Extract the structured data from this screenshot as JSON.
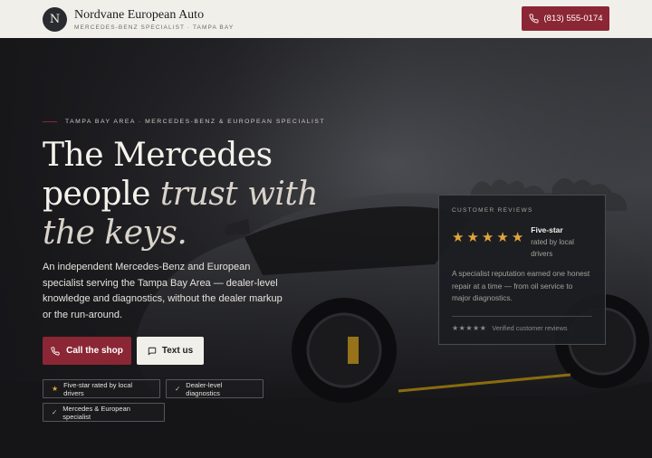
{
  "header": {
    "logo_letter": "N",
    "brand_name": "Nordvane European Auto",
    "brand_sub": "MERCEDES-BENZ SPECIALIST · TAMPA BAY",
    "phone_label": "(813) 555-0174",
    "phone_icon": "phone-icon"
  },
  "hero": {
    "eyebrow": "TAMPA BAY AREA · MERCEDES-BENZ & EUROPEAN SPECIALIST",
    "headline_line1": "The Mercedes",
    "headline_line2_plain": "people ",
    "headline_line2_italic": "trust with",
    "headline_line3_italic": "the keys.",
    "lead": "An independent Mercedes-Benz and European specialist serving the Tampa Bay Area — dealer-level knowledge and diagnostics, without the dealer markup or the run-around.",
    "call_label": "Call the shop",
    "text_label": "Text us",
    "chips": [
      {
        "label": "Five-star rated by local drivers",
        "icon": "star-icon"
      },
      {
        "label": "Dealer-level diagnostics",
        "icon": "check-icon"
      },
      {
        "label": "Mercedes & European specialist",
        "icon": "check-icon"
      }
    ]
  },
  "reviews": {
    "label": "CUSTOMER REVIEWS",
    "rating_stars": 5,
    "title": "Five-star",
    "note": "rated by local drivers",
    "body": "A specialist reputation earned one honest repair at a time — from oil service to major diagnostics.",
    "footer_stars": "★★★★★",
    "footer_text": "Verified customer reviews"
  },
  "colors": {
    "accent": "#8b2635",
    "star": "#e0a53a",
    "header_bg": "#f1efea"
  }
}
